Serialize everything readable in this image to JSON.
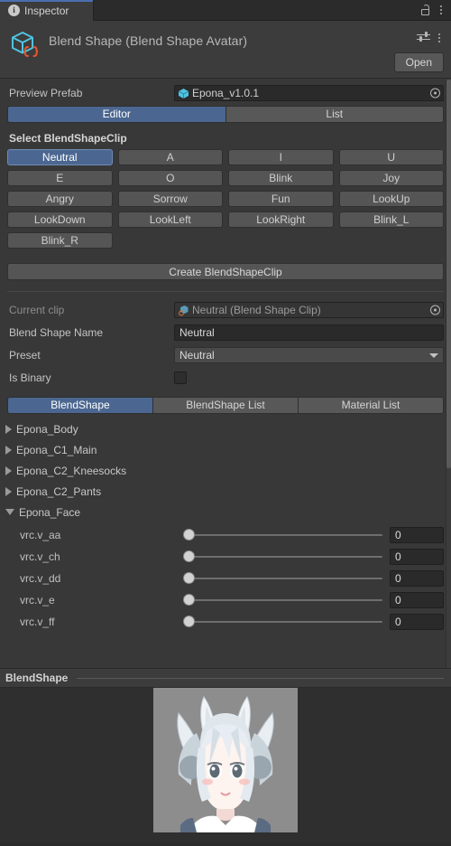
{
  "tabbar": {
    "tab_label": "Inspector",
    "info_icon": "info-icon",
    "lock_icon": "lock-icon",
    "menu_icon": "kebab-menu-icon"
  },
  "header": {
    "title": "Blend Shape (Blend Shape Avatar)",
    "icon": "scriptable-object-cube-icon",
    "preset_icon": "preset-sliders-icon",
    "menu_icon": "kebab-menu-icon",
    "open_button": "Open"
  },
  "preview_prefab": {
    "label": "Preview Prefab",
    "value": "Epona_v1.0.1",
    "icon": "prefab-cube-icon",
    "picker_icon": "object-picker-icon"
  },
  "mode_tabs": {
    "items": [
      {
        "label": "Editor",
        "active": true
      },
      {
        "label": "List",
        "active": false
      }
    ]
  },
  "select_clip": {
    "title": "Select BlendShapeClip",
    "clips": [
      {
        "label": "Neutral",
        "active": true
      },
      {
        "label": "A",
        "active": false
      },
      {
        "label": "I",
        "active": false
      },
      {
        "label": "U",
        "active": false
      },
      {
        "label": "E",
        "active": false
      },
      {
        "label": "O",
        "active": false
      },
      {
        "label": "Blink",
        "active": false
      },
      {
        "label": "Joy",
        "active": false
      },
      {
        "label": "Angry",
        "active": false
      },
      {
        "label": "Sorrow",
        "active": false
      },
      {
        "label": "Fun",
        "active": false
      },
      {
        "label": "LookUp",
        "active": false
      },
      {
        "label": "LookDown",
        "active": false
      },
      {
        "label": "LookLeft",
        "active": false
      },
      {
        "label": "LookRight",
        "active": false
      },
      {
        "label": "Blink_L",
        "active": false
      },
      {
        "label": "Blink_R",
        "active": false
      }
    ],
    "create_button": "Create BlendShapeClip"
  },
  "clip_props": {
    "current_clip_label": "Current clip",
    "current_clip_value": "Neutral (Blend Shape Clip)",
    "current_clip_icon": "blend-shape-clip-icon",
    "blend_shape_name_label": "Blend Shape Name",
    "blend_shape_name_value": "Neutral",
    "preset_label": "Preset",
    "preset_value": "Neutral",
    "is_binary_label": "Is Binary",
    "is_binary_checked": false
  },
  "content_tabs": {
    "items": [
      {
        "label": "BlendShape",
        "active": true
      },
      {
        "label": "BlendShape List",
        "active": false
      },
      {
        "label": "Material List",
        "active": false
      }
    ]
  },
  "mesh_tree": [
    {
      "label": "Epona_Body",
      "expanded": false
    },
    {
      "label": "Epona_C1_Main",
      "expanded": false
    },
    {
      "label": "Epona_C2_Kneesocks",
      "expanded": false
    },
    {
      "label": "Epona_C2_Pants",
      "expanded": false
    },
    {
      "label": "Epona_Face",
      "expanded": true
    }
  ],
  "blendshape_sliders": [
    {
      "label": "vrc.v_aa",
      "value": "0",
      "percent": 0
    },
    {
      "label": "vrc.v_ch",
      "value": "0",
      "percent": 0
    },
    {
      "label": "vrc.v_dd",
      "value": "0",
      "percent": 0
    },
    {
      "label": "vrc.v_e",
      "value": "0",
      "percent": 0
    },
    {
      "label": "vrc.v_ff",
      "value": "0",
      "percent": 0
    }
  ],
  "preview": {
    "title": "BlendShape",
    "avatar_alt": "avatar-face-preview"
  },
  "colors": {
    "accent_blue": "#4b6791",
    "tab_top_line": "#4b6eaf",
    "panel_bg": "#383838",
    "header_bg": "#3c3c3c",
    "button_bg": "#555555",
    "field_bg": "#2a2a2a",
    "icon_cyan": "#4ec3e0",
    "icon_orange": "#e8552d"
  }
}
